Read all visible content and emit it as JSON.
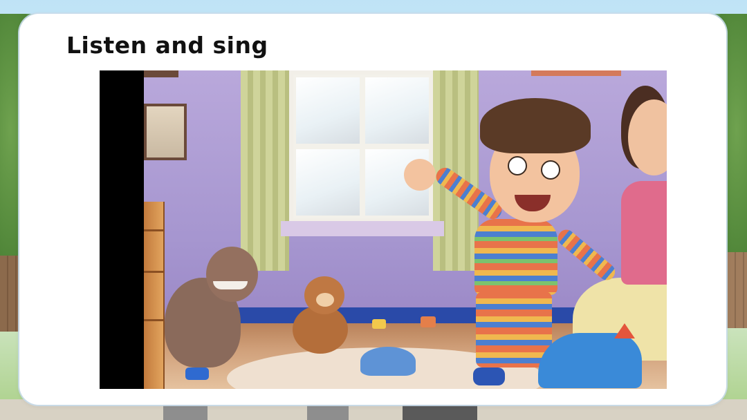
{
  "slide": {
    "title": "Listen and sing"
  },
  "video": {
    "description_icon": "video-frame"
  }
}
